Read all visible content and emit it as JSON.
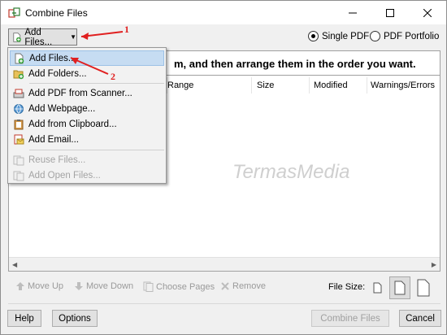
{
  "window": {
    "title": "Combine Files",
    "app_icon": "combine-files-icon",
    "controls": [
      "minimize-icon",
      "maximize-icon",
      "close-icon"
    ]
  },
  "toolbar": {
    "add_files_label": "Add Files...",
    "output_mode": {
      "options": [
        "Single PDF",
        "PDF Portfolio"
      ],
      "selected": "Single PDF"
    }
  },
  "banner": {
    "text": "m, and then arrange them in the order you want."
  },
  "file_list": {
    "columns": [
      "Range",
      "Size",
      "Modified",
      "Warnings/Errors"
    ],
    "rows": []
  },
  "dropdown": {
    "items": [
      {
        "label": "Add Files...",
        "icon": "add-file-icon",
        "enabled": true,
        "highlighted": true
      },
      {
        "label": "Add Folders...",
        "icon": "add-folder-icon",
        "enabled": true
      },
      {
        "label": "Add PDF from Scanner...",
        "icon": "scanner-icon",
        "enabled": true
      },
      {
        "label": "Add Webpage...",
        "icon": "webpage-icon",
        "enabled": true
      },
      {
        "label": "Add from Clipboard...",
        "icon": "clipboard-icon",
        "enabled": true
      },
      {
        "label": "Add Email...",
        "icon": "email-icon",
        "enabled": true
      },
      {
        "label": "Reuse Files...",
        "icon": "reuse-files-icon",
        "enabled": false
      },
      {
        "label": "Add Open Files...",
        "icon": "open-files-icon",
        "enabled": false
      }
    ]
  },
  "list_tools": {
    "move_up": "Move Up",
    "move_down": "Move Down",
    "choose_pages": "Choose Pages",
    "remove": "Remove",
    "file_size_label": "File Size:",
    "file_size_options": [
      "small-page-icon",
      "medium-page-icon",
      "large-page-icon"
    ],
    "file_size_selected": "medium-page-icon"
  },
  "footer": {
    "help": "Help",
    "options": "Options",
    "combine": "Combine Files",
    "cancel": "Cancel"
  },
  "annotations": {
    "step1": "1",
    "step2": "2",
    "color": "#e02020"
  },
  "watermark": "TermasMedia",
  "colors": {
    "menu_highlight": "#c6dcf2",
    "annotation_red": "#e02020"
  }
}
